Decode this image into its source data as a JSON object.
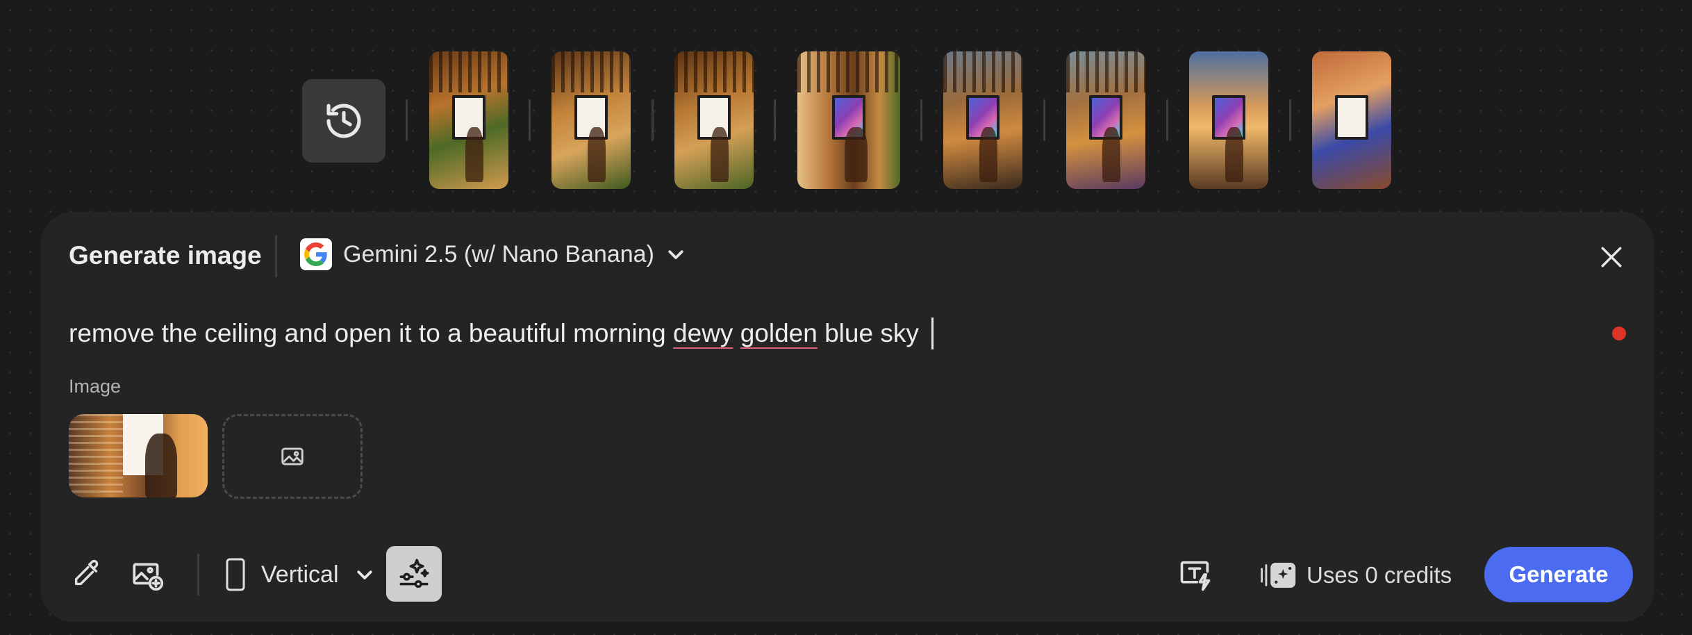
{
  "history": {
    "icon": "history-icon",
    "thumbnails": [
      {
        "sign": "blank"
      },
      {
        "sign": "blank"
      },
      {
        "sign": "blank"
      },
      {
        "sign": "art"
      },
      {
        "sign": "art"
      },
      {
        "sign": "art"
      },
      {
        "sign": "art"
      },
      {
        "sign": "blank"
      }
    ]
  },
  "panel": {
    "title": "Generate image",
    "model": {
      "name": "Gemini 2.5 (w/ Nano Banana)",
      "icon": "google-logo-icon"
    },
    "close_icon": "close-icon",
    "prompt": {
      "text_before": "remove the ceiling and open it to a beautiful morning",
      "misspelled_1": "dewy",
      "misspelled_2": "golden",
      "text_after": "blue sky"
    },
    "image_section": {
      "label": "Image"
    },
    "toolbar": {
      "aspect_ratio": "Vertical",
      "credits": "Uses 0 credits",
      "generate_label": "Generate"
    }
  },
  "colors": {
    "background": "#1b1b1b",
    "panel": "#242424",
    "accent": "#4b6cf0",
    "record_dot": "#e0342b"
  }
}
